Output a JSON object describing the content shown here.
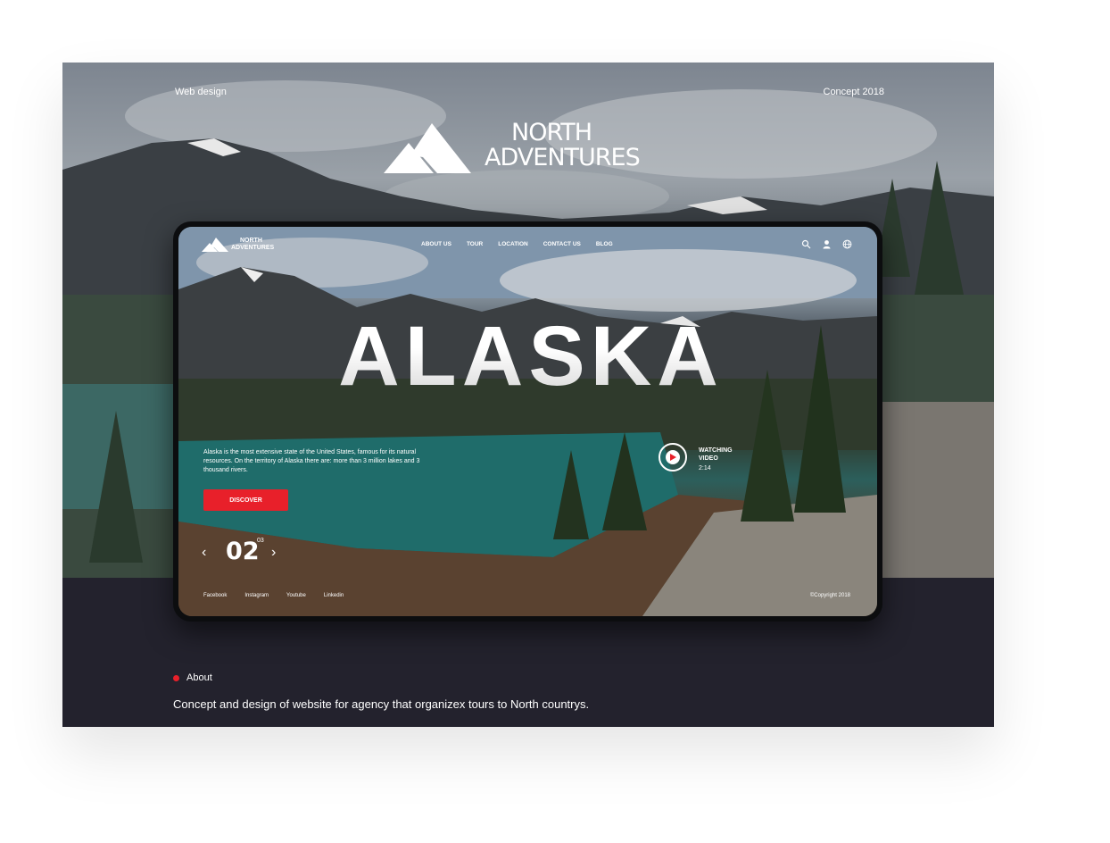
{
  "page": {
    "top_left": "Web design",
    "top_right": "Concept 2018",
    "brand": {
      "line1": "NORTH",
      "line2": "ADVENTURES"
    }
  },
  "site": {
    "logo_line1": "NORTH",
    "logo_line2": "ADVENTURES",
    "nav": [
      "ABOUT US",
      "TOUR",
      "LOCATION",
      "CONTACT US",
      "BLOG"
    ],
    "icons": [
      "search-icon",
      "user-icon",
      "globe-icon"
    ],
    "hero_title": "ALASKA",
    "description": "Alaska is the most extensive state of the United States, famous for its natural resources. On the territory of Alaska there are: more than 3 million lakes and 3 thousand rivers.",
    "cta": "DISCOVER",
    "slide": {
      "prev": "‹",
      "current": "02",
      "total": "03",
      "next": "›"
    },
    "video": {
      "label_line1": "WATCHING",
      "label_line2": "VIDEO",
      "time": "2:14"
    },
    "social": [
      "Facebook",
      "Instagram",
      "Youtube",
      "Linkedin"
    ],
    "copyright": "©Copyright 2018"
  },
  "about": {
    "label": "About",
    "text": "Concept and design of website for agency that organizex tours to North countrys."
  },
  "colors": {
    "accent": "#e8202a",
    "footer_bg": "#23222d"
  }
}
